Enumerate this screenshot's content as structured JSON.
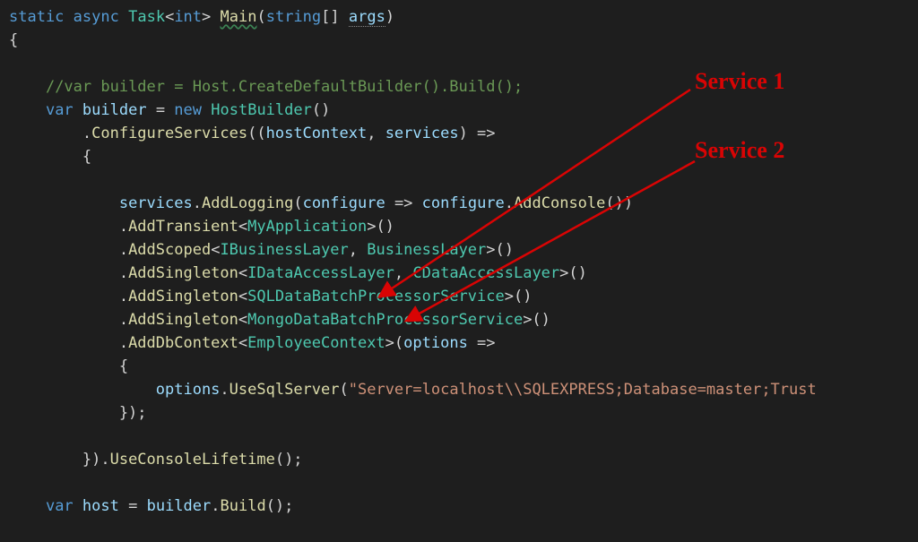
{
  "code": {
    "line01": {
      "kw1": "static",
      "kw2": "async",
      "type": "Task",
      "kw3": "int",
      "fn": "Main",
      "kw4": "string",
      "id": "args"
    },
    "line03_comment": "//var builder = Host.CreateDefaultBuilder().Build();",
    "line04": {
      "kw1": "var",
      "id": "builder",
      "kw2": "new",
      "type": "HostBuilder"
    },
    "line05": {
      "fn": "ConfigureServices",
      "id1": "hostContext",
      "id2": "services"
    },
    "line08": {
      "id1": "services",
      "fn1": "AddLogging",
      "id2": "configure",
      "id3": "configure",
      "fn2": "AddConsole"
    },
    "line09": {
      "fn": "AddTransient",
      "type": "MyApplication"
    },
    "line10": {
      "fn": "AddScoped",
      "type1": "IBusinessLayer",
      "type2": "BusinessLayer"
    },
    "line11": {
      "fn": "AddSingleton",
      "type1": "IDataAccessLayer",
      "type2": "CDataAccessLayer"
    },
    "line12": {
      "fn": "AddSingleton",
      "type": "SQLDataBatchProcessorService"
    },
    "line13": {
      "fn": "AddSingleton",
      "type": "MongoDataBatchProcessorService"
    },
    "line14": {
      "fn": "AddDbContext",
      "type": "EmployeeContext",
      "id": "options"
    },
    "line16": {
      "id": "options",
      "fn": "UseSqlServer",
      "str": "\"Server=localhost\\\\SQLEXPRESS;Database=master;Trust"
    },
    "line19": {
      "fn": "UseConsoleLifetime"
    },
    "line21": {
      "kw": "var",
      "id1": "host",
      "id2": "builder",
      "fn": "Build"
    }
  },
  "annotations": {
    "label1": "Service 1",
    "label2": "Service 2"
  }
}
